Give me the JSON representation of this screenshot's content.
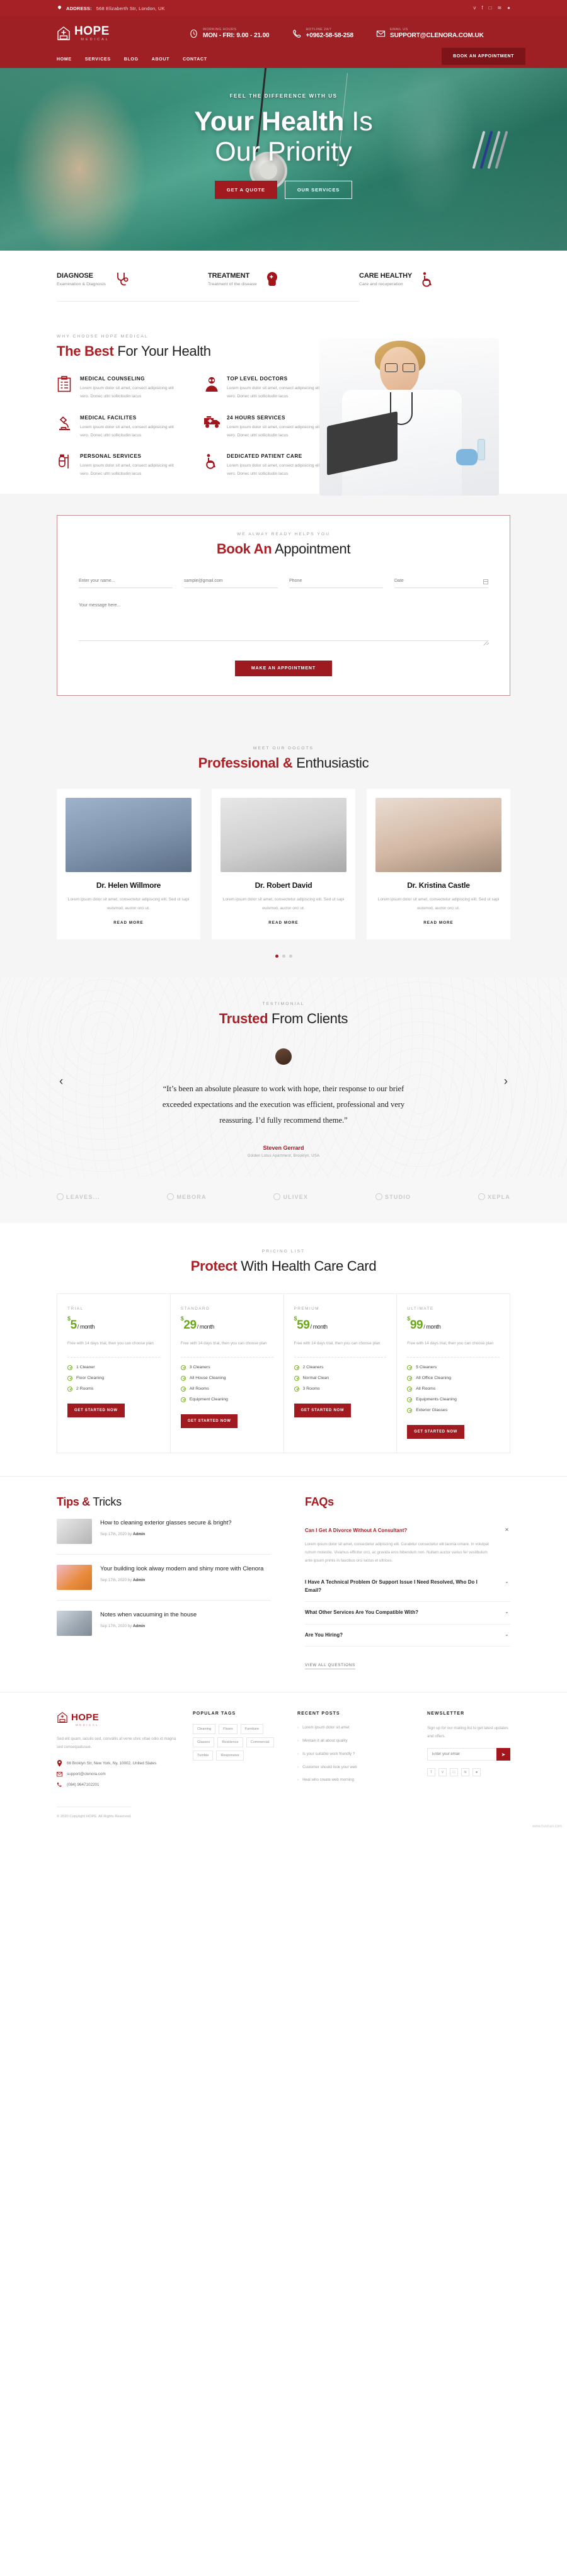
{
  "topbar": {
    "address_label": "ADDRESS:",
    "address": "568 Elizaberth Str, London, UK",
    "socials": [
      "twitter-icon",
      "facebook-icon",
      "instagram-icon",
      "rss-icon",
      "dribbble-icon"
    ],
    "social_glyphs": [
      "ᴠ",
      "f",
      "□",
      "≋",
      "●"
    ]
  },
  "header": {
    "logo_name": "HOPE",
    "logo_sub": "MEDICAL",
    "info": [
      {
        "label": "WORKING HOURS",
        "value": "MON - FRI: 9.00 - 21.00",
        "icon": "clock-icon"
      },
      {
        "label": "HOTLINE 24/7",
        "value": "+0962-58-58-258",
        "icon": "phone-icon"
      },
      {
        "label": "EMAIL US",
        "value": "SUPPORT@CLENORA.COM.UK",
        "icon": "mail-icon"
      }
    ],
    "nav": [
      "HOME",
      "SERVICES",
      "BLOG",
      "ABOUT",
      "CONTACT"
    ],
    "cta": "BOOK AN APPOINTMENT"
  },
  "hero": {
    "kicker": "FEEL THE DIFFERENCE WITH US",
    "title_bold": "Your Health",
    "title_light": " Is",
    "title_line2": "Our Priority",
    "btn_primary": "GET A QUOTE",
    "btn_secondary": "OUR SERVICES"
  },
  "feature_strip": [
    {
      "title": "DIAGNOSE",
      "subtitle": "Examination & Diagnosis",
      "icon": "stethoscope-icon"
    },
    {
      "title": "TREATMENT",
      "subtitle": "Treatment of the disease",
      "icon": "brain-icon"
    },
    {
      "title": "CARE HEALTHY",
      "subtitle": "Care and recuperation",
      "icon": "wheelchair-icon"
    }
  ],
  "why": {
    "kicker": "WHY CHOOSE HOPE MEDICAL",
    "title_bold": "The Best",
    "title_light": " For Your Health",
    "items": [
      {
        "title": "MEDICAL COUNSELING",
        "text": "Lorem ipsum dolor sit amet, consect adipisicing elit vero. Donec ultri sollicitudin lacus",
        "icon": "clipboard-icon"
      },
      {
        "title": "TOP LEVEL DOCTORS",
        "text": "Lorem ipsum dolor sit amet, consect adipisicing elit vero. Donec ultri sollicitudin lacus",
        "icon": "doctor-icon"
      },
      {
        "title": "MEDICAL FACILITES",
        "text": "Lorem ipsum dolor sit amet, consect adipisicing elit vero. Donec ultri sollicitudin lacus",
        "icon": "microscope-icon"
      },
      {
        "title": "24 HOURS SERVICES",
        "text": "Lorem ipsum dolor sit amet, consect adipisicing elit vero. Donec ultri sollicitudin lacus",
        "icon": "ambulance-icon"
      },
      {
        "title": "PERSONAL SERVICES",
        "text": "Lorem ipsum dolor sit amet, consect adipisicing elit vero. Donec ultri sollicitudin lacus",
        "icon": "iv-drip-icon"
      },
      {
        "title": "DEDICATED PATIENT CARE",
        "text": "Lorem ipsum dolor sit amet, consect adipisicing elit vero. Donec ultri sollicitudin lacus",
        "icon": "wheelchair-icon"
      }
    ]
  },
  "appointment": {
    "kicker": "WE ALWAY READY HELPS YOU",
    "title_bold": "Book An",
    "title_light": " Appointment",
    "fields": {
      "name_placeholder": "Enter your name...",
      "email_placeholder": "sample@gmail.com",
      "phone_placeholder": "Phone",
      "date_placeholder": "Date",
      "message_placeholder": "Your message here..."
    },
    "submit": "MAKE AN APPOINTMENT"
  },
  "doctors": {
    "kicker": "MEET OUR DOCOTS",
    "title_bold": "Professional &",
    "title_light": " Enthusiastic",
    "read_more": "READ MORE",
    "cards": [
      {
        "name": "Dr. Helen Willmore",
        "text": "Lorem ipsum dolor sit amet, consectetur adipiscing elit. Sed ut sapi euismod, auctor orci ut."
      },
      {
        "name": "Dr. Robert David",
        "text": "Lorem ipsum dolor sit amet, consectetur adipiscing elit. Sed ut sapi euismod, auctor orci ut."
      },
      {
        "name": "Dr. Kristina Castle",
        "text": "Lorem ipsum dolor sit amet, consectetur adipiscing elit. Sed ut sapi euismod, auctor orci ut."
      }
    ]
  },
  "testimonial": {
    "kicker": "TESTIMONIAL",
    "title_bold": "Trusted",
    "title_light": " From Clients",
    "quote": "“It’s been an absolute pleasure to work with hope, their response to our brief exceeded expectations and the execution was efficient, professional and very reassuring. I’d fully recommend theme.”",
    "author": "Steven Gerrard",
    "author_role": "Golden Lotus Apartment, Brooklyn, USA",
    "prev": "‹",
    "next": "›"
  },
  "brands": [
    {
      "name": "LEAVES...",
      "icon": "leaf-icon"
    },
    {
      "name": "MEBORA",
      "icon": "circle-icon"
    },
    {
      "name": "ULIVEX",
      "icon": "bar-icon"
    },
    {
      "name": "STUDIO",
      "icon": "diamond-icon"
    },
    {
      "name": "XEPLA",
      "icon": "x-icon"
    }
  ],
  "pricing": {
    "kicker": "PRICING LIST",
    "title_bold": "Protect",
    "title_light": " With Health Care Card",
    "note": "Free with 14 days trial, then you can choose plan",
    "per": "/ month",
    "cta": "GET STARTED NOW",
    "plans": [
      {
        "tier": "TRIAL",
        "currency": "$",
        "price": "5",
        "features": [
          "1 Cleaner",
          "Floor Cleaning",
          "2 Rooms"
        ]
      },
      {
        "tier": "STANDARD",
        "currency": "$",
        "price": "29",
        "features": [
          "3 Cleaners",
          "All House Cleaning",
          "All Rooms",
          "Equipment Cleaning"
        ]
      },
      {
        "tier": "PREMIUM",
        "currency": "$",
        "price": "59",
        "features": [
          "2 Cleaners",
          "Normal Clean",
          "3 Rooms"
        ]
      },
      {
        "tier": "ULTIMATE",
        "currency": "$",
        "price": "99",
        "features": [
          "5 Cleaners",
          "All Office Cleaning",
          "All Rooms",
          "Equipments Cleaning",
          "Exterior Glasses"
        ]
      }
    ]
  },
  "tips": {
    "title_bold": "Tips &",
    "title_light": " Tricks",
    "posts": [
      {
        "title": "How to cleaning exterior glasses secure & bright?",
        "date": "Sep 17th, 2020 by ",
        "author": "Admin"
      },
      {
        "title": "Your building look alway modern and shiny more with Clenora",
        "date": "Sep 17th, 2020 by ",
        "author": "Admin"
      },
      {
        "title": "Notes when vacuuming in the house",
        "date": "Sep 17th, 2020 by ",
        "author": "Admin"
      }
    ]
  },
  "faqs": {
    "title": "FAQs",
    "view_all": "VIEW ALL QUESTIONS",
    "items": [
      {
        "q": "Can I Get A Divorce Without A Consultant?",
        "a": "Lorem ipsum dolor sit amet, consectetur adipiscing elit. Curabitur consectetur elit lacinia ornare. In volutpat rutrum molestie. Vivamus efficitur orci, ac gravida eros bibendum non. Nullam auctor varius fer vestibulum ante ipsum primis in faucibus orci luctus et ultrices.",
        "open": true,
        "toggle": "✕"
      },
      {
        "q": "I Have A Technical Problem Or Support Issue I Need Resolved, Who Do I Email?",
        "a": "",
        "open": false,
        "toggle": "⌄"
      },
      {
        "q": "What Other Services Are You Compatible With?",
        "a": "",
        "open": false,
        "toggle": "⌄"
      },
      {
        "q": "Are You Hiring?",
        "a": "",
        "open": false,
        "toggle": "⌄"
      }
    ]
  },
  "footer": {
    "logo_name": "HOPE",
    "logo_sub": "MEDICAL",
    "about": "Sed elit quam, iaculis sed, convallis at vene utvic vitae odio id magna sed consequatusue.",
    "contact": [
      {
        "icon": "location-icon",
        "text": "66 Broklyn Str, New York, Ny, 10002, United States"
      },
      {
        "icon": "mail-icon",
        "text": "support@clenora.com"
      },
      {
        "icon": "phone-icon",
        "text": "(084) 9647102201"
      }
    ],
    "tags_title": "POPULAR TAGS",
    "tags": [
      "Cleaning",
      "Floors",
      "Furniture",
      "Glasses",
      "Residence",
      "Commercial",
      "Tumble",
      "Responsive"
    ],
    "recent_title": "RECENT POSTS",
    "recent": [
      "Lorem ipsum dolor sit amet",
      "Mentain it all about quality",
      "Is your suitable work friendly ?",
      "Customer should look your web",
      "Heal who create web morning"
    ],
    "newsletter_title": "NEWSLETTER",
    "newsletter_text": "Sign up for our mailing list to get latest updates and offers.",
    "newsletter_placeholder": "Enter your email",
    "newsletter_btn": "➤",
    "socials": [
      "f",
      "ᴠ",
      "□",
      "≋",
      "●"
    ],
    "copyright": "© 2020 Copyright HOPE. All Rights Reserved.",
    "watermark": "www.hushan.com"
  }
}
